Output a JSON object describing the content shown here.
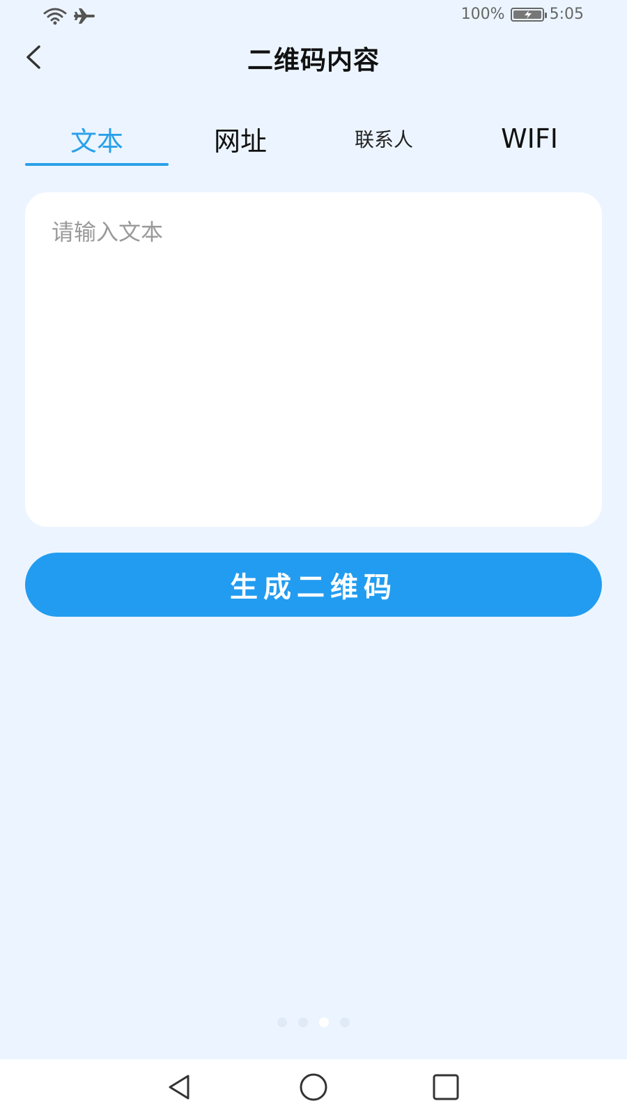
{
  "status_bar": {
    "battery_text": "100%",
    "time": "5:05",
    "battery_level": 1.0
  },
  "header": {
    "title": "二维码内容"
  },
  "tabs": [
    {
      "label": "文本",
      "active": true
    },
    {
      "label": "网址",
      "active": false
    },
    {
      "label": "联系人",
      "active": false
    },
    {
      "label": "WIFI",
      "active": false
    }
  ],
  "input": {
    "placeholder": "请输入文本",
    "value": ""
  },
  "generate_button": {
    "label": "生成二维码"
  },
  "page_indicator": {
    "count": 4,
    "active_index": 2
  },
  "colors": {
    "accent": "#2aa0e8",
    "button": "#229cf0",
    "background": "#ecf5ff"
  }
}
